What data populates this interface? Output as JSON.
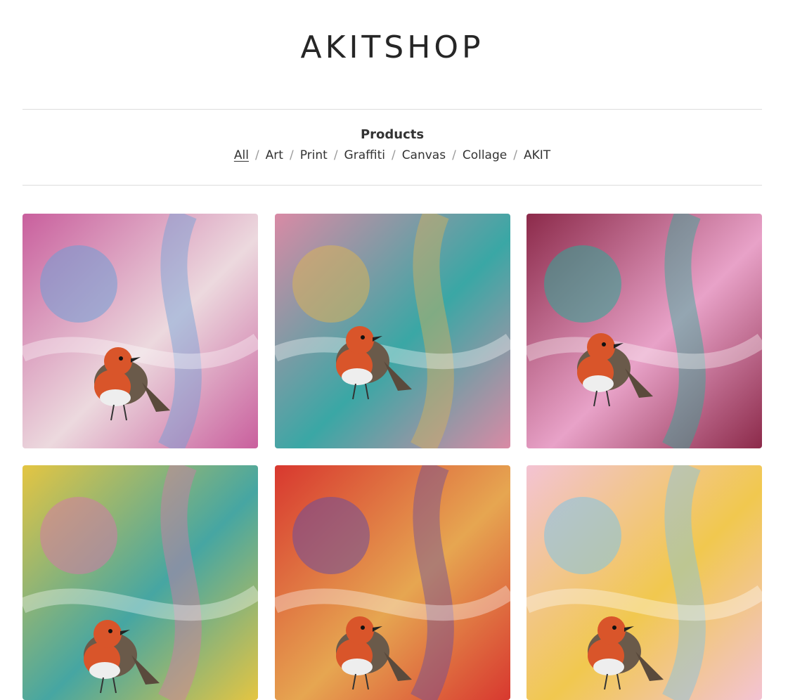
{
  "shop": {
    "title": "AKITSHOP"
  },
  "nav": {
    "heading": "Products",
    "categories": [
      {
        "label": "All",
        "active": true
      },
      {
        "label": "Art"
      },
      {
        "label": "Print"
      },
      {
        "label": "Graffiti"
      },
      {
        "label": "Canvas"
      },
      {
        "label": "Collage"
      },
      {
        "label": "AKIT"
      }
    ]
  },
  "products": [
    {
      "image": "robin-painting-pink-blue",
      "colors": [
        "#c95f9d",
        "#6f9fd6",
        "#ecd9de"
      ]
    },
    {
      "image": "robin-painting-pink-teal-splatter",
      "colors": [
        "#d98aa5",
        "#d7b25a",
        "#3aa7a5"
      ]
    },
    {
      "image": "robin-painting-crimson-teal",
      "colors": [
        "#8c2a4a",
        "#2eaa97",
        "#e8a2c8"
      ]
    },
    {
      "image": "robin-painting-yellow-pink",
      "colors": [
        "#e4c542",
        "#d27aa8",
        "#46a6a2"
      ]
    },
    {
      "image": "robin-painting-red-purple",
      "colors": [
        "#d8382f",
        "#6b4e9c",
        "#e6a651"
      ]
    },
    {
      "image": "robin-painting-pastel-rainbow",
      "colors": [
        "#f3c3d3",
        "#7fc4e3",
        "#f1c84f"
      ]
    }
  ]
}
